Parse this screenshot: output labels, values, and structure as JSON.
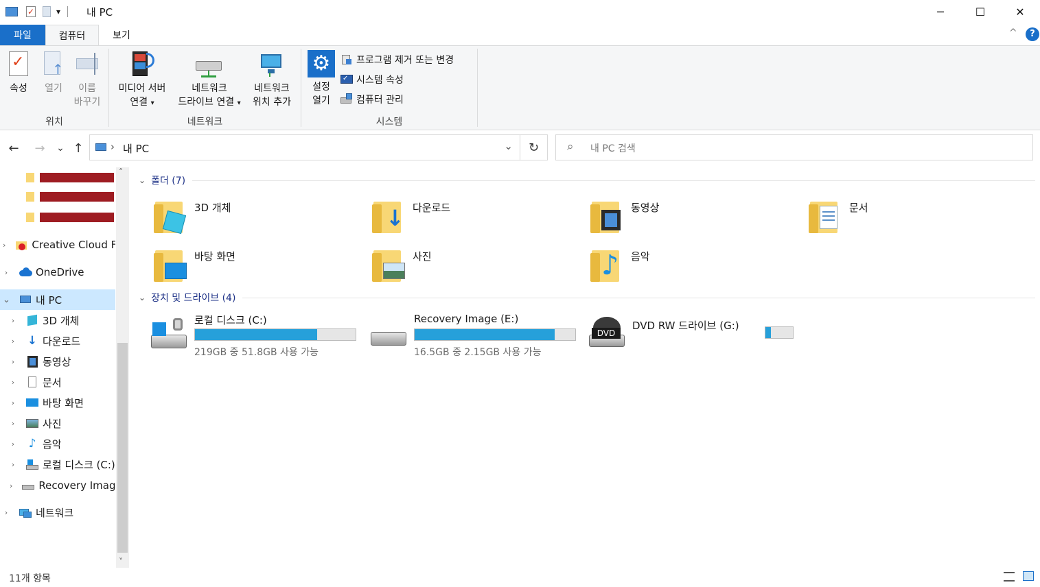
{
  "window": {
    "title": "내 PC",
    "minimize_icon": "─",
    "maximize_icon": "☐",
    "close_icon": "✕",
    "qa_dropdown_icon": "▾",
    "help_icon": "?",
    "collapse_icon": "^"
  },
  "ribbon": {
    "tabs": {
      "file": "파일",
      "computer": "컴퓨터",
      "view": "보기"
    },
    "groups": {
      "location": {
        "label": "위치",
        "properties": "속성",
        "open": "열기",
        "rename_line1": "이름",
        "rename_line2": "바꾸기"
      },
      "network": {
        "label": "네트워크",
        "media_line1": "미디어 서버",
        "media_line2": "연결",
        "map_line1": "네트워크",
        "map_line2": "드라이브 연결",
        "addloc_line1": "네트워크",
        "addloc_line2": "위치 추가"
      },
      "system": {
        "label": "시스템",
        "settings_line1": "설정",
        "settings_line2": "열기",
        "uninstall": "프로그램 제거 또는 변경",
        "sysprops": "시스템 속성",
        "manage": "컴퓨터 관리"
      }
    },
    "dropdown_arrow": "▾"
  },
  "address": {
    "back_icon": "←",
    "forward_icon": "→",
    "recent_icon": "⌄",
    "up_icon": "↑",
    "separator": "›",
    "path": "내 PC",
    "dropdown_icon": "⌄",
    "refresh_icon": "↻",
    "search_placeholder": "내 PC 검색",
    "search_icon": "⌕"
  },
  "nav": {
    "expand_icon": "›",
    "expanded_icon": "⌄",
    "scroll_up": "˄",
    "scroll_down": "˅",
    "items": [
      {
        "label": "Creative Cloud Fi"
      },
      {
        "label": "OneDrive"
      },
      {
        "label": "내 PC"
      },
      {
        "label": "3D 개체"
      },
      {
        "label": "다운로드"
      },
      {
        "label": "동영상"
      },
      {
        "label": "문서"
      },
      {
        "label": "바탕 화면"
      },
      {
        "label": "사진"
      },
      {
        "label": "음악"
      },
      {
        "label": "로컬 디스크 (C:)"
      },
      {
        "label": "Recovery Image"
      },
      {
        "label": "네트워크"
      }
    ]
  },
  "content": {
    "collapse_icon": "⌄",
    "folders_header": "폴더 (7)",
    "folders": [
      {
        "label": "3D 개체"
      },
      {
        "label": "다운로드"
      },
      {
        "label": "동영상"
      },
      {
        "label": "문서"
      },
      {
        "label": "바탕 화면"
      },
      {
        "label": "사진"
      },
      {
        "label": "음악"
      }
    ],
    "drives_header": "장치 및 드라이브 (4)",
    "drives": [
      {
        "label": "로컬 디스크 (C:)",
        "size": "219GB 중 51.8GB 사용 가능",
        "used_fraction": 0.76
      },
      {
        "label": "Recovery Image (E:)",
        "size": "16.5GB 중 2.15GB 사용 가능",
        "used_fraction": 0.87
      },
      {
        "label": "DVD RW 드라이브 (G:)",
        "used_fraction": 0.2
      }
    ],
    "dvd_badge": "DVD"
  },
  "status": {
    "count": "11개 항목"
  },
  "colors": {
    "accent": "#1a6fc9",
    "selection": "#cce8ff",
    "bar_fill": "#26a0da",
    "redaction": "#9e1c22"
  }
}
